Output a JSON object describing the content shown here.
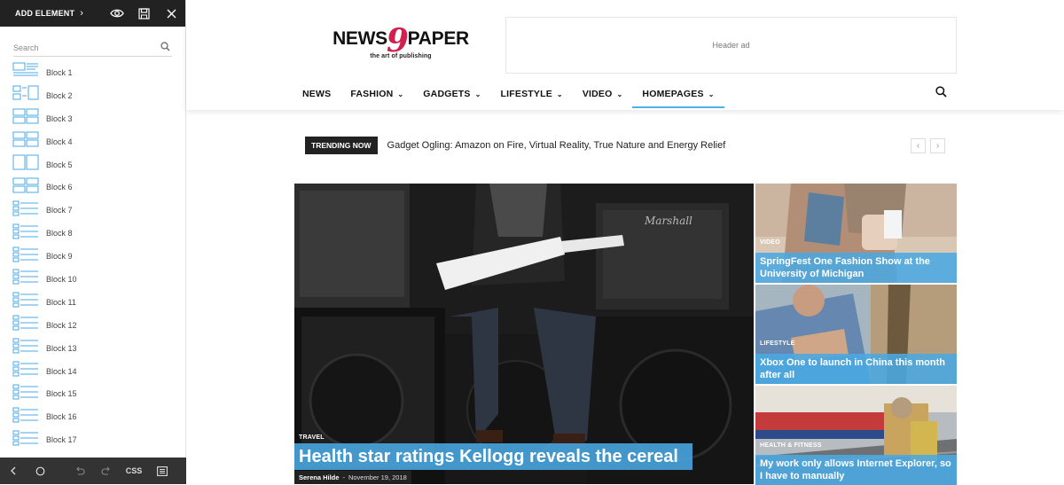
{
  "sidebar": {
    "add_element": "ADD ELEMENT",
    "search_placeholder": "Search",
    "blocks": [
      "Block 1",
      "Block 2",
      "Block 3",
      "Block 4",
      "Block 5",
      "Block 6",
      "Block 7",
      "Block 8",
      "Block 9",
      "Block 10",
      "Block 11",
      "Block 12",
      "Block 13",
      "Block 14",
      "Block 15",
      "Block 16",
      "Block 17"
    ],
    "css_label": "CSS"
  },
  "header": {
    "logo_left": "NEWS",
    "logo_nine": "9",
    "logo_right": "PAPER",
    "logo_tagline": "the art of publishing",
    "ad_label": "Header ad",
    "nav": [
      {
        "label": "NEWS"
      },
      {
        "label": "FASHION"
      },
      {
        "label": "GADGETS"
      },
      {
        "label": "LIFESTYLE"
      },
      {
        "label": "VIDEO"
      },
      {
        "label": "HOMEPAGES"
      }
    ]
  },
  "trending": {
    "badge": "TRENDING NOW",
    "title": "Gadget Ogling: Amazon on Fire, Virtual Reality, True Nature and Energy Relief",
    "prev": "‹",
    "next": "›"
  },
  "featured": {
    "main": {
      "category": "TRAVEL",
      "title": "Health star ratings Kellogg reveals the cereal",
      "author": "Serena Hilde",
      "separator": "-",
      "date": "November 19, 2018"
    },
    "side": [
      {
        "category": "VIDEO",
        "title": "SpringFest One Fashion Show at the University of Michigan"
      },
      {
        "category": "LIFESTYLE",
        "title": "Xbox One to launch in China this month after all"
      },
      {
        "category": "HEALTH & FITNESS",
        "title": "My work only allows Internet Explorer, so I have to manually"
      }
    ]
  },
  "colors": {
    "accent": "#4db2ec",
    "logo_nine": "#d21f4e",
    "sidebar_dark": "#222222"
  }
}
